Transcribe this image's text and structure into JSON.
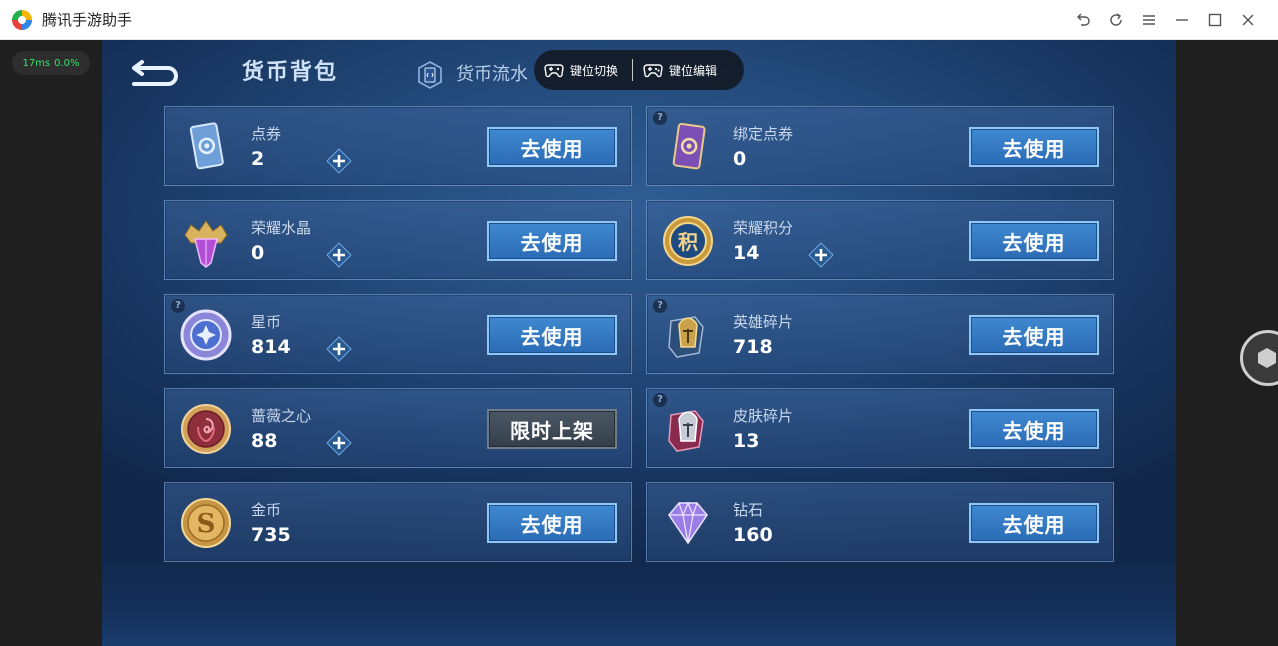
{
  "window": {
    "title": "腾讯手游助手",
    "controls": [
      "undo-icon",
      "refresh-icon",
      "menu-icon",
      "minimize-icon",
      "maximize-icon",
      "close-icon"
    ]
  },
  "perf": {
    "latency": "17ms",
    "cpu": "0.0%"
  },
  "header": {
    "tab_bag": "货币背包",
    "tab_flow": "货币流水",
    "key_switch": "键位切换",
    "key_edit": "键位编辑"
  },
  "currencies": [
    {
      "name": "点券",
      "count": "2",
      "has_plus": true,
      "button": "去使用"
    },
    {
      "name": "绑定点券",
      "count": "0",
      "has_plus": false,
      "button": "去使用",
      "help": "?"
    },
    {
      "name": "荣耀水晶",
      "count": "0",
      "has_plus": true,
      "button": "去使用"
    },
    {
      "name": "荣耀积分",
      "count": "14",
      "has_plus": true,
      "button": "去使用"
    },
    {
      "name": "星币",
      "count": "814",
      "has_plus": true,
      "button": "去使用",
      "help": "?"
    },
    {
      "name": "英雄碎片",
      "count": "718",
      "has_plus": false,
      "button": "去使用",
      "help": "?"
    },
    {
      "name": "蔷薇之心",
      "count": "88",
      "has_plus": true,
      "button": "限时上架"
    },
    {
      "name": "皮肤碎片",
      "count": "13",
      "has_plus": false,
      "button": "去使用",
      "help": "?"
    },
    {
      "name": "金币",
      "count": "735",
      "has_plus": false,
      "button": "去使用"
    },
    {
      "name": "钻石",
      "count": "160",
      "has_plus": false,
      "button": "去使用"
    }
  ],
  "colors": {
    "accent_button": "#3f89d0",
    "perf_text": "#35e26b"
  }
}
